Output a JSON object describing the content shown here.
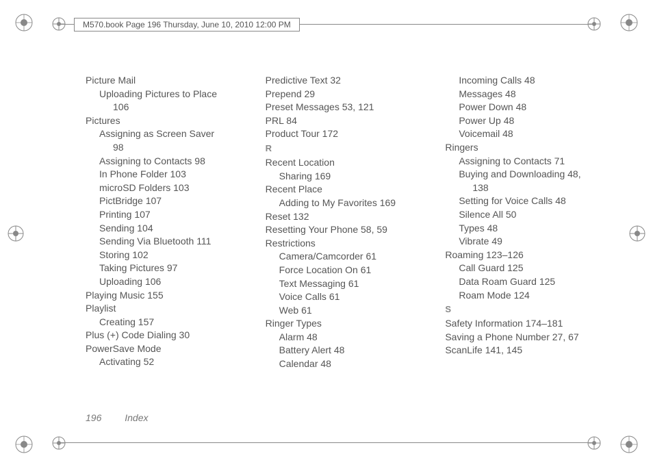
{
  "header": "M570.book  Page 196  Thursday, June 10, 2010  12:00 PM",
  "footer": {
    "page": "196",
    "section": "Index"
  },
  "columns": [
    [
      {
        "cls": "l0",
        "text": "Picture Mail"
      },
      {
        "cls": "l1",
        "text": "Uploading Pictures to Place"
      },
      {
        "cls": "l2",
        "text": "106"
      },
      {
        "cls": "l0",
        "text": "Pictures"
      },
      {
        "cls": "l1",
        "text": "Assigning as Screen Saver"
      },
      {
        "cls": "l2",
        "text": "98"
      },
      {
        "cls": "l1",
        "text": "Assigning to Contacts 98"
      },
      {
        "cls": "l1",
        "text": "In Phone Folder 103"
      },
      {
        "cls": "l1",
        "text": "microSD Folders 103"
      },
      {
        "cls": "l1",
        "text": "PictBridge 107"
      },
      {
        "cls": "l1",
        "text": "Printing 107"
      },
      {
        "cls": "l1",
        "text": "Sending 104"
      },
      {
        "cls": "l1",
        "text": "Sending Via Bluetooth 111"
      },
      {
        "cls": "l1",
        "text": "Storing 102"
      },
      {
        "cls": "l1",
        "text": "Taking Pictures 97"
      },
      {
        "cls": "l1",
        "text": "Uploading 106"
      },
      {
        "cls": "l0",
        "text": "Playing Music 155"
      },
      {
        "cls": "l0",
        "text": "Playlist"
      },
      {
        "cls": "l1",
        "text": "Creating 157"
      },
      {
        "cls": "l0",
        "text": "Plus (+) Code Dialing 30"
      },
      {
        "cls": "l0",
        "text": "PowerSave Mode"
      },
      {
        "cls": "l1",
        "text": "Activating 52"
      }
    ],
    [
      {
        "cls": "l0",
        "text": "Predictive Text 32"
      },
      {
        "cls": "l0",
        "text": "Prepend 29"
      },
      {
        "cls": "l0",
        "text": "Preset Messages 53, 121"
      },
      {
        "cls": "l0",
        "text": "PRL 84"
      },
      {
        "cls": "l0",
        "text": "Product Tour 172"
      },
      {
        "cls": "alpha",
        "text": "R"
      },
      {
        "cls": "l0",
        "text": "Recent Location"
      },
      {
        "cls": "l1",
        "text": "Sharing 169"
      },
      {
        "cls": "l0",
        "text": "Recent Place"
      },
      {
        "cls": "l1",
        "text": "Adding to My Favorites 169"
      },
      {
        "cls": "l0",
        "text": "Reset 132"
      },
      {
        "cls": "l0",
        "text": "Resetting Your Phone 58, 59"
      },
      {
        "cls": "l0",
        "text": "Restrictions"
      },
      {
        "cls": "l1",
        "text": "Camera/Camcorder 61"
      },
      {
        "cls": "l1",
        "text": "Force Location On 61"
      },
      {
        "cls": "l1",
        "text": "Text Messaging 61"
      },
      {
        "cls": "l1",
        "text": "Voice Calls 61"
      },
      {
        "cls": "l1",
        "text": "Web 61"
      },
      {
        "cls": "l0",
        "text": "Ringer Types"
      },
      {
        "cls": "l1",
        "text": "Alarm 48"
      },
      {
        "cls": "l1",
        "text": "Battery Alert 48"
      },
      {
        "cls": "l1",
        "text": "Calendar 48"
      }
    ],
    [
      {
        "cls": "l1",
        "text": "Incoming Calls 48"
      },
      {
        "cls": "l1",
        "text": "Messages 48"
      },
      {
        "cls": "l1",
        "text": "Power Down 48"
      },
      {
        "cls": "l1",
        "text": "Power Up 48"
      },
      {
        "cls": "l1",
        "text": "Voicemail 48"
      },
      {
        "cls": "l0",
        "text": "Ringers"
      },
      {
        "cls": "l1",
        "text": "Assigning to Contacts 71"
      },
      {
        "cls": "l1",
        "text": "Buying and Downloading 48,"
      },
      {
        "cls": "l2",
        "text": "138"
      },
      {
        "cls": "l1",
        "text": "Setting for Voice Calls 48"
      },
      {
        "cls": "l1",
        "text": "Silence All 50"
      },
      {
        "cls": "l1",
        "text": "Types 48"
      },
      {
        "cls": "l1",
        "text": "Vibrate 49"
      },
      {
        "cls": "l0",
        "text": "Roaming 123–126"
      },
      {
        "cls": "l1",
        "text": "Call Guard 125"
      },
      {
        "cls": "l1",
        "text": "Data Roam Guard 125"
      },
      {
        "cls": "l1",
        "text": "Roam Mode 124"
      },
      {
        "cls": "alpha",
        "text": "S"
      },
      {
        "cls": "l0",
        "text": "Safety Information 174–181"
      },
      {
        "cls": "l0",
        "text": "Saving a Phone Number 27, 67"
      },
      {
        "cls": "l0",
        "text": "ScanLife 141, 145"
      }
    ]
  ]
}
